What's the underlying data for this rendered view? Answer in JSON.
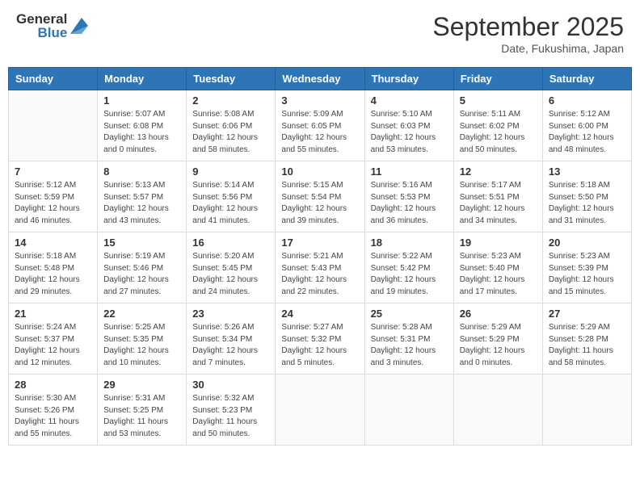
{
  "header": {
    "logo_line1": "General",
    "logo_line2": "Blue",
    "month": "September 2025",
    "location": "Date, Fukushima, Japan"
  },
  "weekdays": [
    "Sunday",
    "Monday",
    "Tuesday",
    "Wednesday",
    "Thursday",
    "Friday",
    "Saturday"
  ],
  "weeks": [
    [
      {
        "day": "",
        "info": ""
      },
      {
        "day": "1",
        "info": "Sunrise: 5:07 AM\nSunset: 6:08 PM\nDaylight: 13 hours\nand 0 minutes."
      },
      {
        "day": "2",
        "info": "Sunrise: 5:08 AM\nSunset: 6:06 PM\nDaylight: 12 hours\nand 58 minutes."
      },
      {
        "day": "3",
        "info": "Sunrise: 5:09 AM\nSunset: 6:05 PM\nDaylight: 12 hours\nand 55 minutes."
      },
      {
        "day": "4",
        "info": "Sunrise: 5:10 AM\nSunset: 6:03 PM\nDaylight: 12 hours\nand 53 minutes."
      },
      {
        "day": "5",
        "info": "Sunrise: 5:11 AM\nSunset: 6:02 PM\nDaylight: 12 hours\nand 50 minutes."
      },
      {
        "day": "6",
        "info": "Sunrise: 5:12 AM\nSunset: 6:00 PM\nDaylight: 12 hours\nand 48 minutes."
      }
    ],
    [
      {
        "day": "7",
        "info": "Sunrise: 5:12 AM\nSunset: 5:59 PM\nDaylight: 12 hours\nand 46 minutes."
      },
      {
        "day": "8",
        "info": "Sunrise: 5:13 AM\nSunset: 5:57 PM\nDaylight: 12 hours\nand 43 minutes."
      },
      {
        "day": "9",
        "info": "Sunrise: 5:14 AM\nSunset: 5:56 PM\nDaylight: 12 hours\nand 41 minutes."
      },
      {
        "day": "10",
        "info": "Sunrise: 5:15 AM\nSunset: 5:54 PM\nDaylight: 12 hours\nand 39 minutes."
      },
      {
        "day": "11",
        "info": "Sunrise: 5:16 AM\nSunset: 5:53 PM\nDaylight: 12 hours\nand 36 minutes."
      },
      {
        "day": "12",
        "info": "Sunrise: 5:17 AM\nSunset: 5:51 PM\nDaylight: 12 hours\nand 34 minutes."
      },
      {
        "day": "13",
        "info": "Sunrise: 5:18 AM\nSunset: 5:50 PM\nDaylight: 12 hours\nand 31 minutes."
      }
    ],
    [
      {
        "day": "14",
        "info": "Sunrise: 5:18 AM\nSunset: 5:48 PM\nDaylight: 12 hours\nand 29 minutes."
      },
      {
        "day": "15",
        "info": "Sunrise: 5:19 AM\nSunset: 5:46 PM\nDaylight: 12 hours\nand 27 minutes."
      },
      {
        "day": "16",
        "info": "Sunrise: 5:20 AM\nSunset: 5:45 PM\nDaylight: 12 hours\nand 24 minutes."
      },
      {
        "day": "17",
        "info": "Sunrise: 5:21 AM\nSunset: 5:43 PM\nDaylight: 12 hours\nand 22 minutes."
      },
      {
        "day": "18",
        "info": "Sunrise: 5:22 AM\nSunset: 5:42 PM\nDaylight: 12 hours\nand 19 minutes."
      },
      {
        "day": "19",
        "info": "Sunrise: 5:23 AM\nSunset: 5:40 PM\nDaylight: 12 hours\nand 17 minutes."
      },
      {
        "day": "20",
        "info": "Sunrise: 5:23 AM\nSunset: 5:39 PM\nDaylight: 12 hours\nand 15 minutes."
      }
    ],
    [
      {
        "day": "21",
        "info": "Sunrise: 5:24 AM\nSunset: 5:37 PM\nDaylight: 12 hours\nand 12 minutes."
      },
      {
        "day": "22",
        "info": "Sunrise: 5:25 AM\nSunset: 5:35 PM\nDaylight: 12 hours\nand 10 minutes."
      },
      {
        "day": "23",
        "info": "Sunrise: 5:26 AM\nSunset: 5:34 PM\nDaylight: 12 hours\nand 7 minutes."
      },
      {
        "day": "24",
        "info": "Sunrise: 5:27 AM\nSunset: 5:32 PM\nDaylight: 12 hours\nand 5 minutes."
      },
      {
        "day": "25",
        "info": "Sunrise: 5:28 AM\nSunset: 5:31 PM\nDaylight: 12 hours\nand 3 minutes."
      },
      {
        "day": "26",
        "info": "Sunrise: 5:29 AM\nSunset: 5:29 PM\nDaylight: 12 hours\nand 0 minutes."
      },
      {
        "day": "27",
        "info": "Sunrise: 5:29 AM\nSunset: 5:28 PM\nDaylight: 11 hours\nand 58 minutes."
      }
    ],
    [
      {
        "day": "28",
        "info": "Sunrise: 5:30 AM\nSunset: 5:26 PM\nDaylight: 11 hours\nand 55 minutes."
      },
      {
        "day": "29",
        "info": "Sunrise: 5:31 AM\nSunset: 5:25 PM\nDaylight: 11 hours\nand 53 minutes."
      },
      {
        "day": "30",
        "info": "Sunrise: 5:32 AM\nSunset: 5:23 PM\nDaylight: 11 hours\nand 50 minutes."
      },
      {
        "day": "",
        "info": ""
      },
      {
        "day": "",
        "info": ""
      },
      {
        "day": "",
        "info": ""
      },
      {
        "day": "",
        "info": ""
      }
    ]
  ]
}
